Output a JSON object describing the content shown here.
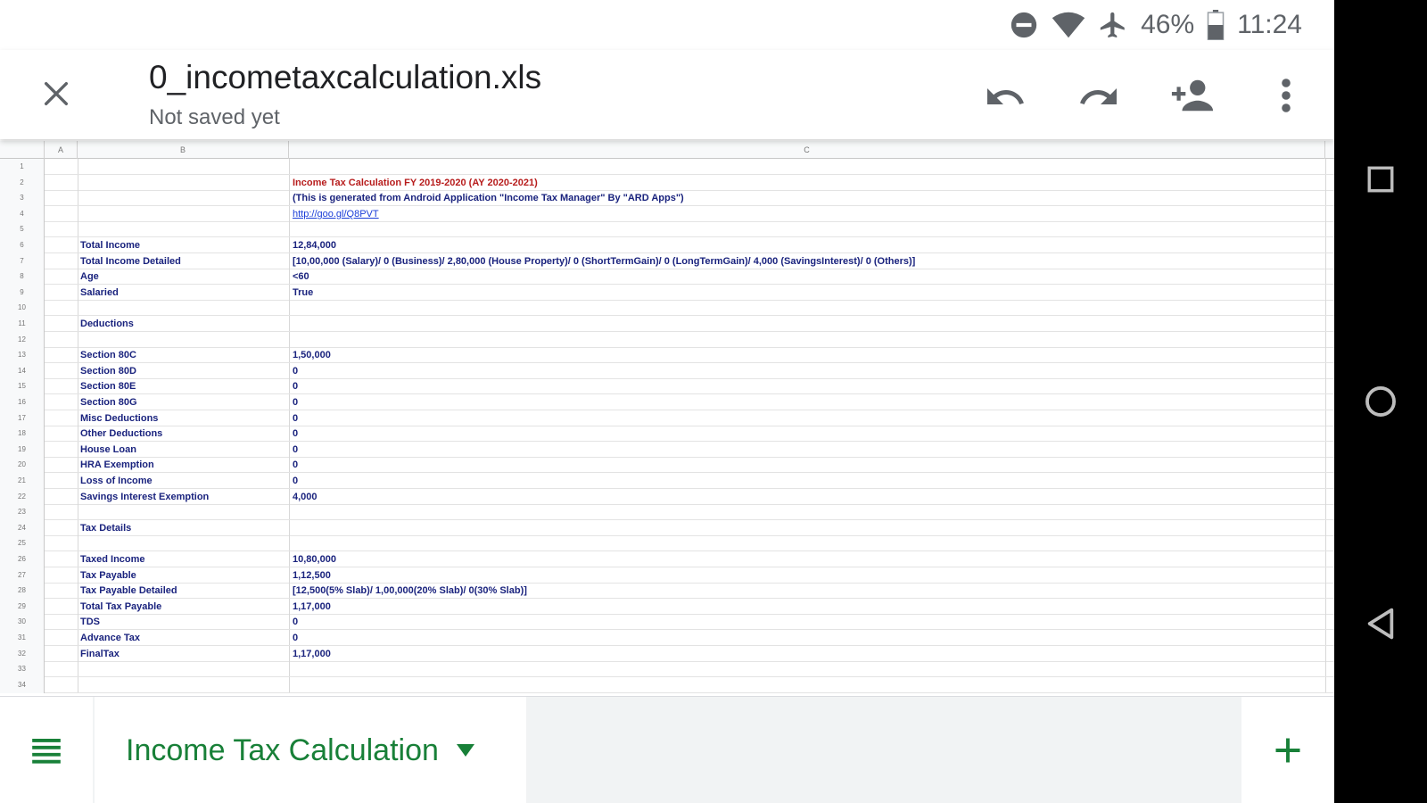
{
  "status_bar": {
    "battery": "46%",
    "time": "11:24",
    "icons": [
      "do-not-disturb-icon",
      "wifi-icon",
      "airplane-icon",
      "battery-icon"
    ]
  },
  "app_bar": {
    "title": "0_incometaxcalculation.xls",
    "subtitle": "Not saved yet",
    "icons": [
      "close-icon",
      "undo-icon",
      "redo-icon",
      "add-person-icon",
      "more-vert-icon"
    ]
  },
  "sheet": {
    "column_headers": [
      "A",
      "B",
      "C"
    ],
    "rows": [
      {
        "n": "1",
        "b": "",
        "c": ""
      },
      {
        "n": "2",
        "b": "",
        "c": "Income Tax Calculation FY 2019-2020 (AY 2020-2021)",
        "style": "red"
      },
      {
        "n": "3",
        "b": "",
        "c": "(This is generated from Android Application \"Income Tax Manager\" By \"ARD Apps\")"
      },
      {
        "n": "4",
        "b": "",
        "c": "http://goo.gl/Q8PVT",
        "style": "link"
      },
      {
        "n": "5",
        "b": "",
        "c": ""
      },
      {
        "n": "6",
        "b": "Total Income",
        "c": "12,84,000"
      },
      {
        "n": "7",
        "b": "Total Income Detailed",
        "c": "[10,00,000 (Salary)/ 0 (Business)/ 2,80,000 (House Property)/ 0 (ShortTermGain)/ 0 (LongTermGain)/ 4,000 (SavingsInterest)/ 0 (Others)]"
      },
      {
        "n": "8",
        "b": "Age",
        "c": "<60"
      },
      {
        "n": "9",
        "b": "Salaried",
        "c": "True"
      },
      {
        "n": "10",
        "b": "",
        "c": ""
      },
      {
        "n": "11",
        "b": "Deductions",
        "c": ""
      },
      {
        "n": "12",
        "b": "",
        "c": ""
      },
      {
        "n": "13",
        "b": "Section 80C",
        "c": "1,50,000"
      },
      {
        "n": "14",
        "b": "Section 80D",
        "c": "0"
      },
      {
        "n": "15",
        "b": "Section 80E",
        "c": "0"
      },
      {
        "n": "16",
        "b": "Section 80G",
        "c": "0"
      },
      {
        "n": "17",
        "b": "Misc Deductions",
        "c": "0"
      },
      {
        "n": "18",
        "b": "Other Deductions",
        "c": "0"
      },
      {
        "n": "19",
        "b": "House Loan",
        "c": "0"
      },
      {
        "n": "20",
        "b": "HRA Exemption",
        "c": "0"
      },
      {
        "n": "21",
        "b": "Loss of Income",
        "c": "0"
      },
      {
        "n": "22",
        "b": "Savings Interest Exemption",
        "c": "4,000"
      },
      {
        "n": "23",
        "b": "",
        "c": ""
      },
      {
        "n": "24",
        "b": "Tax Details",
        "c": ""
      },
      {
        "n": "25",
        "b": "",
        "c": ""
      },
      {
        "n": "26",
        "b": "Taxed Income",
        "c": "10,80,000"
      },
      {
        "n": "27",
        "b": "Tax Payable",
        "c": "1,12,500"
      },
      {
        "n": "28",
        "b": "Tax Payable Detailed",
        "c": "[12,500(5% Slab)/ 1,00,000(20% Slab)/ 0(30% Slab)]"
      },
      {
        "n": "29",
        "b": "Total Tax Payable",
        "c": "1,17,000"
      },
      {
        "n": "30",
        "b": "TDS",
        "c": "0"
      },
      {
        "n": "31",
        "b": "Advance Tax",
        "c": "0"
      },
      {
        "n": "32",
        "b": "FinalTax",
        "c": "1,17,000"
      },
      {
        "n": "33",
        "b": "",
        "c": ""
      },
      {
        "n": "34",
        "b": "",
        "c": ""
      }
    ]
  },
  "bottom_bar": {
    "sheet_tab_label": "Income Tax Calculation",
    "icons": [
      "sheets-list-icon",
      "dropdown-caret-icon",
      "add-sheet-icon"
    ]
  },
  "nav_bar": {
    "icons": [
      "recents-icon",
      "home-icon",
      "back-icon"
    ]
  },
  "colors": {
    "accent_green": "#188038",
    "cell_text_blue": "#1a237e",
    "cell_text_red": "#b71c1c",
    "link_blue": "#1a3dd8"
  }
}
